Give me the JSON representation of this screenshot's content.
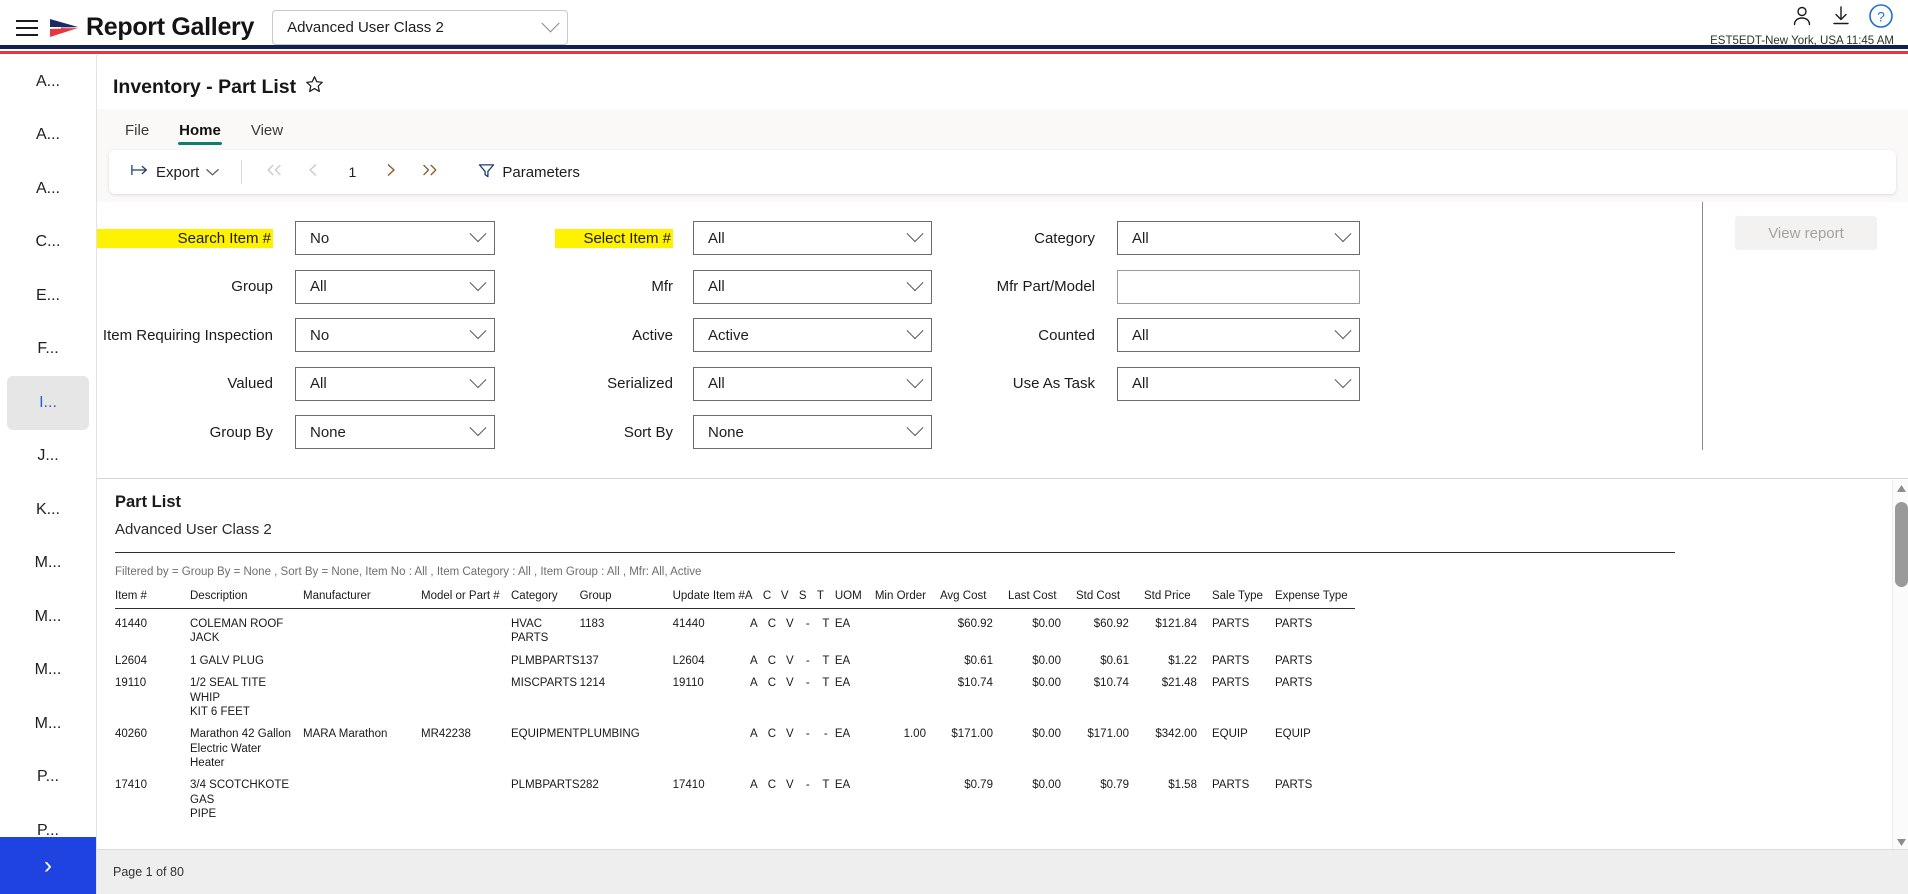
{
  "appbar": {
    "menu_icon": "hamburger-icon",
    "logo_icon": "arrow-logo-icon",
    "title": "Report Gallery",
    "class_select": {
      "value": "Advanced User Class 2",
      "chevron": "chevron-down-icon"
    },
    "account_icon": "person-icon",
    "download_icon": "download-icon",
    "help_icon": "help-circle-icon",
    "timezone": "EST5EDT-New York, USA 11:45 AM"
  },
  "rail": {
    "items": [
      {
        "label": "A...",
        "active": false
      },
      {
        "label": "A...",
        "active": false
      },
      {
        "label": "A...",
        "active": false
      },
      {
        "label": "C...",
        "active": false
      },
      {
        "label": "E...",
        "active": false
      },
      {
        "label": "F...",
        "active": false
      },
      {
        "label": "I...",
        "active": true
      },
      {
        "label": "J...",
        "active": false
      },
      {
        "label": "K...",
        "active": false
      },
      {
        "label": "M...",
        "active": false
      },
      {
        "label": "M...",
        "active": false
      },
      {
        "label": "M...",
        "active": false
      },
      {
        "label": "M...",
        "active": false
      },
      {
        "label": "P...",
        "active": false
      },
      {
        "label": "P...",
        "active": false
      }
    ],
    "expand_label": "›"
  },
  "report": {
    "title": "Inventory - Part List",
    "favorite_icon": "star-outline-icon"
  },
  "ribbon": {
    "tabs": [
      {
        "label": "File",
        "active": false
      },
      {
        "label": "Home",
        "active": true
      },
      {
        "label": "View",
        "active": false
      }
    ],
    "export_label": "Export",
    "export_icon": "export-arrow-icon",
    "first_page_icon": "double-chevron-left-icon",
    "prev_page_icon": "chevron-left-icon",
    "page_number": "1",
    "next_page_icon": "chevron-right-icon",
    "last_page_icon": "double-chevron-right-icon",
    "parameters_label": "Parameters",
    "parameters_icon": "filter-funnel-icon"
  },
  "parameters": {
    "col1": [
      {
        "label": "Search Item #",
        "value": "No",
        "type": "select",
        "highlight": true
      },
      {
        "label": "Group",
        "value": "All",
        "type": "select",
        "highlight": false
      },
      {
        "label": "Item Requiring Inspection",
        "value": "No",
        "type": "select",
        "highlight": false
      },
      {
        "label": "Valued",
        "value": "All",
        "type": "select",
        "highlight": false
      },
      {
        "label": "Group By",
        "value": "None",
        "type": "select",
        "highlight": false
      }
    ],
    "col2": [
      {
        "label": "Select Item #",
        "value": "All",
        "type": "select",
        "highlight": true
      },
      {
        "label": "Mfr",
        "value": "All",
        "type": "select",
        "highlight": false
      },
      {
        "label": "Active",
        "value": "Active",
        "type": "select",
        "highlight": false
      },
      {
        "label": "Serialized",
        "value": "All",
        "type": "select",
        "highlight": false
      },
      {
        "label": "Sort By",
        "value": "None",
        "type": "select",
        "highlight": false
      }
    ],
    "col3": [
      {
        "label": "Category",
        "value": "All",
        "type": "select",
        "highlight": false
      },
      {
        "label": "Mfr Part/Model",
        "value": "",
        "type": "text",
        "highlight": false
      },
      {
        "label": "Counted",
        "value": "All",
        "type": "select",
        "highlight": false
      },
      {
        "label": "Use As Task",
        "value": "All",
        "type": "select",
        "highlight": false
      }
    ],
    "view_report_label": "View report"
  },
  "viewer": {
    "heading": "Part List",
    "subheading": "Advanced User Class 2",
    "filter_text": "Filtered by = Group By = None , Sort By = None, Item No : All , Item Category : All , Item Group : All , Mfr: All, Active",
    "columns": [
      "Item #",
      "Description",
      "Manufacturer",
      "Model or Part #",
      "Category",
      "Group",
      "Update Item #",
      "A",
      "C",
      "V",
      "S",
      "T",
      "UOM",
      "Min Order",
      "Avg Cost",
      "Last Cost",
      "Std Cost",
      "Std Price",
      "Sale Type",
      "Expense Type"
    ],
    "rows": [
      {
        "item": "41440",
        "description": "COLEMAN ROOF JACK",
        "manufacturer": "",
        "model": "",
        "category": "HVAC PARTS",
        "group": "1183",
        "update_item": "41440",
        "a": "A",
        "c": "C",
        "v": "V",
        "s": "-",
        "t": "T",
        "uom": "EA",
        "min_order": "",
        "avg_cost": "$60.92",
        "last_cost": "$0.00",
        "std_cost": "$60.92",
        "std_price": "$121.84",
        "sale_type": "PARTS",
        "expense_type": "PARTS"
      },
      {
        "item": "L2604",
        "description": "1 GALV PLUG",
        "manufacturer": "",
        "model": "",
        "category": "PLMBPARTS",
        "group": "137",
        "update_item": "L2604",
        "a": "A",
        "c": "C",
        "v": "V",
        "s": "-",
        "t": "T",
        "uom": "EA",
        "min_order": "",
        "avg_cost": "$0.61",
        "last_cost": "$0.00",
        "std_cost": "$0.61",
        "std_price": "$1.22",
        "sale_type": "PARTS",
        "expense_type": "PARTS"
      },
      {
        "item": "19110",
        "description": "1/2 SEAL TITE WHIP\nKIT 6 FEET",
        "manufacturer": "",
        "model": "",
        "category": "MISCPARTS",
        "group": "1214",
        "update_item": "19110",
        "a": "A",
        "c": "C",
        "v": "V",
        "s": "-",
        "t": "T",
        "uom": "EA",
        "min_order": "",
        "avg_cost": "$10.74",
        "last_cost": "$0.00",
        "std_cost": "$10.74",
        "std_price": "$21.48",
        "sale_type": "PARTS",
        "expense_type": "PARTS"
      },
      {
        "item": "40260",
        "description": "Marathon 42 Gallon\nElectric Water Heater",
        "manufacturer": "MARA Marathon",
        "model": "MR42238",
        "category": "EQUIPMENT",
        "group": "PLUMBING",
        "update_item": "",
        "a": "A",
        "c": "C",
        "v": "V",
        "s": "-",
        "t": "-",
        "uom": "EA",
        "min_order": "1.00",
        "avg_cost": "$171.00",
        "last_cost": "$0.00",
        "std_cost": "$171.00",
        "std_price": "$342.00",
        "sale_type": "EQUIP",
        "expense_type": "EQUIP"
      },
      {
        "item": "17410",
        "description": "3/4 SCOTCHKOTE GAS\nPIPE",
        "manufacturer": "",
        "model": "",
        "category": "PLMBPARTS",
        "group": "282",
        "update_item": "17410",
        "a": "A",
        "c": "C",
        "v": "V",
        "s": "-",
        "t": "T",
        "uom": "EA",
        "min_order": "",
        "avg_cost": "$0.79",
        "last_cost": "$0.00",
        "std_cost": "$0.79",
        "std_price": "$1.58",
        "sale_type": "PARTS",
        "expense_type": "PARTS"
      }
    ],
    "scroll_up_icon": "scroll-up-arrow-icon",
    "scroll_down_icon": "scroll-down-arrow-icon"
  },
  "status": {
    "page_text": "Page 1 of 80"
  },
  "colors": {
    "brand_navy": "#12224f",
    "brand_red": "#e8363d",
    "accent_teal": "#107c6d",
    "highlight_yellow": "#fff200",
    "rail_active_blue": "#2b5fd9",
    "expand_blue": "#1f43e0",
    "pager_active": "#8a5a2b"
  }
}
